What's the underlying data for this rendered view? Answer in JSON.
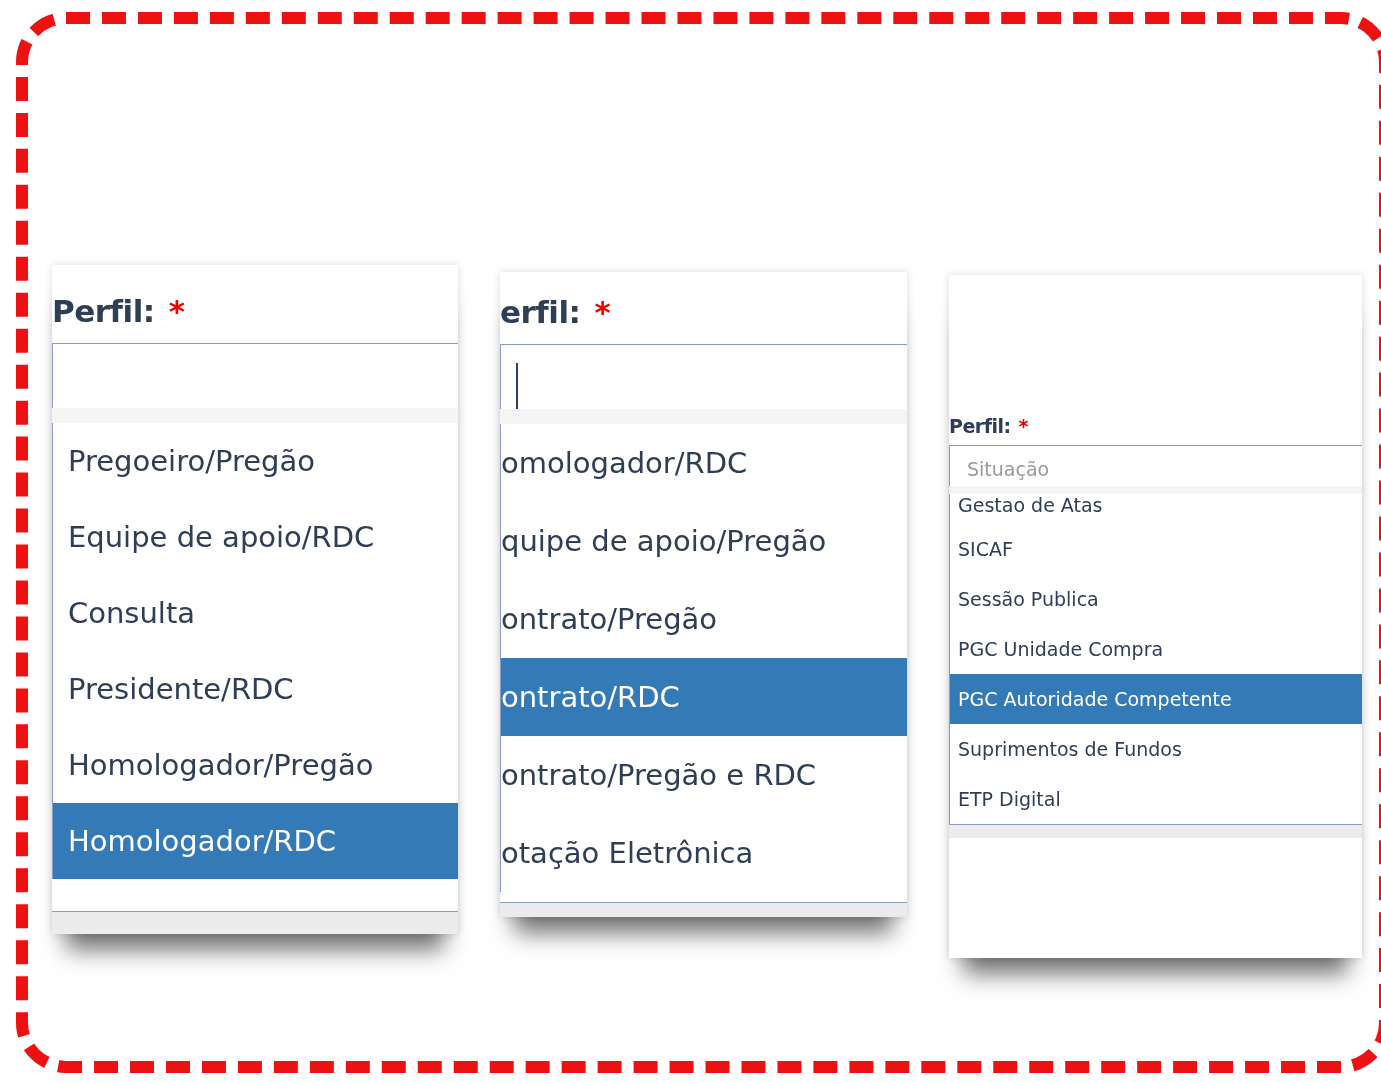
{
  "panels": [
    {
      "label": "Perfil:",
      "required_mark": "*",
      "options": [
        {
          "label": "Pregoeiro/Pregão",
          "selected": false
        },
        {
          "label": "Equipe de apoio/RDC",
          "selected": false
        },
        {
          "label": "Consulta",
          "selected": false
        },
        {
          "label": "Presidente/RDC",
          "selected": false
        },
        {
          "label": "Homologador/Pregão",
          "selected": false
        },
        {
          "label": "Homologador/RDC",
          "selected": true
        }
      ]
    },
    {
      "label": "erfil:",
      "required_mark": "*",
      "field": {
        "focused": true
      },
      "options": [
        {
          "label": "omologador/RDC",
          "selected": false
        },
        {
          "label": "quipe de apoio/Pregão",
          "selected": false
        },
        {
          "label": "ontrato/Pregão",
          "selected": false
        },
        {
          "label": "ontrato/RDC",
          "selected": true
        },
        {
          "label": "ontrato/Pregão e RDC",
          "selected": false
        },
        {
          "label": "otação Eletrônica",
          "selected": false
        }
      ]
    },
    {
      "label": "Perfil:",
      "required_mark": "*",
      "field": {
        "placeholder": "Situação"
      },
      "options": [
        {
          "label": "Gestao de Atas",
          "selected": false
        },
        {
          "label": "SICAF",
          "selected": false
        },
        {
          "label": "Sessão Publica",
          "selected": false
        },
        {
          "label": "PGC Unidade Compra",
          "selected": false
        },
        {
          "label": "PGC Autoridade Competente",
          "selected": true
        },
        {
          "label": "Suprimentos de Fundos",
          "selected": false
        },
        {
          "label": "ETP Digital",
          "selected": false
        }
      ]
    }
  ]
}
